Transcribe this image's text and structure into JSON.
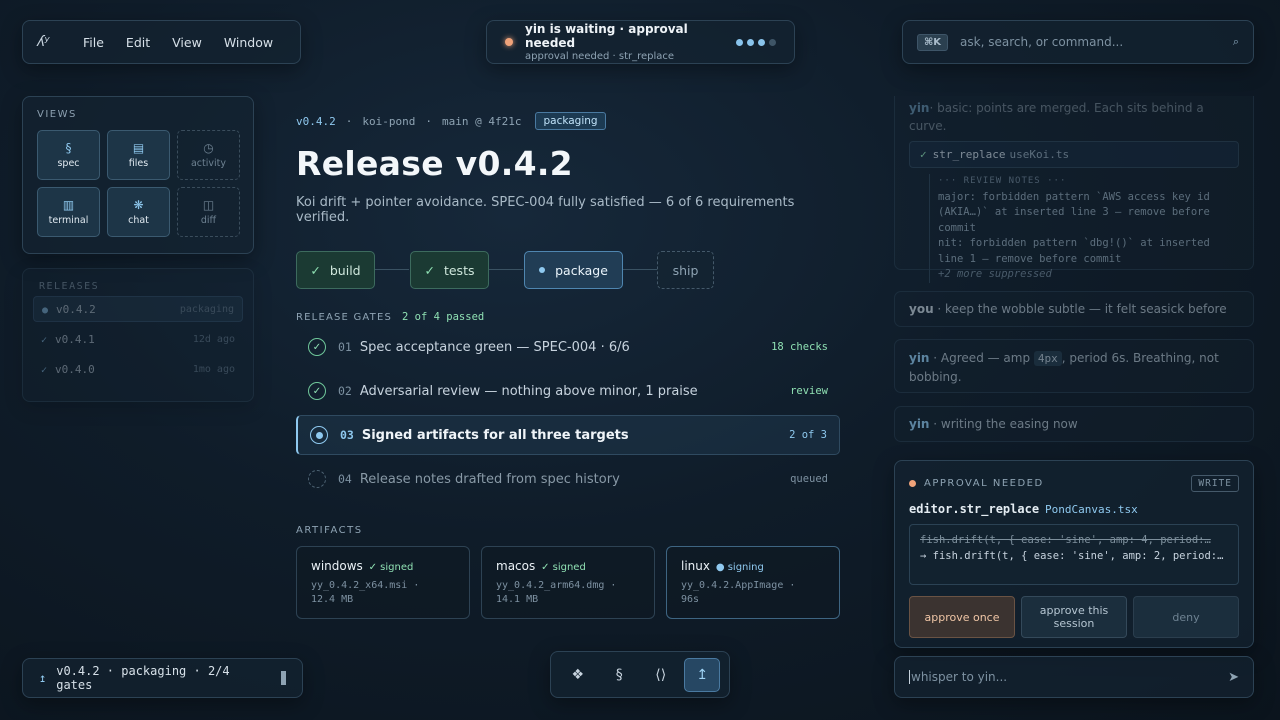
{
  "menubar": {
    "logo": "ʎʸ",
    "items": [
      "File",
      "Edit",
      "View",
      "Window"
    ]
  },
  "status": {
    "title": "yin is waiting · approval needed",
    "subtitle": "approval needed · str_replace",
    "dots_filled": 3,
    "dots_total": 4
  },
  "search": {
    "shortcut": "⌘K",
    "placeholder": "ask, search, or command..."
  },
  "views": {
    "label": "VIEWS",
    "items": [
      {
        "icon": "§",
        "label": "spec"
      },
      {
        "icon": "▤",
        "label": "files"
      },
      {
        "icon": "◷",
        "label": "activity"
      },
      {
        "icon": "▥",
        "label": "terminal"
      },
      {
        "icon": "❋",
        "label": "chat"
      },
      {
        "icon": "◫",
        "label": "diff"
      }
    ]
  },
  "releases": {
    "label": "RELEASES",
    "items": [
      {
        "marker": "●",
        "version": "v0.4.2",
        "meta": "packaging"
      },
      {
        "marker": "✓",
        "version": "v0.4.1",
        "meta": "12d ago"
      },
      {
        "marker": "✓",
        "version": "v0.4.0",
        "meta": "1mo ago"
      }
    ]
  },
  "bottom_status": {
    "icon": "↥",
    "text": "v0.4.2 · packaging · 2/4 gates"
  },
  "dock": {
    "items": [
      "❖",
      "§",
      "⟨⟩",
      "↥"
    ]
  },
  "main": {
    "version": "v0.4.2",
    "repo": "koi-pond",
    "branch": "main @ 4f21c",
    "sep": "·",
    "badge": "packaging",
    "title": "Release v0.4.2",
    "description": "Koi drift + pointer avoidance. SPEC-004 fully satisfied — 6 of 6 requirements verified.",
    "pipeline": [
      {
        "label": "build",
        "state": "done"
      },
      {
        "label": "tests",
        "state": "done"
      },
      {
        "label": "package",
        "state": "current"
      },
      {
        "label": "ship",
        "state": "todo"
      }
    ],
    "gates_label": "RELEASE GATES",
    "gates_count": "2 of 4 passed",
    "gates": [
      {
        "num": "01",
        "label": "Spec acceptance green — SPEC-004 · 6/6",
        "status": "18 checks",
        "state": "done"
      },
      {
        "num": "02",
        "label": "Adversarial review — nothing above minor, 1 praise",
        "status": "review",
        "state": "done"
      },
      {
        "num": "03",
        "label": "Signed artifacts for all three targets",
        "status": "2 of 3",
        "state": "current"
      },
      {
        "num": "04",
        "label": "Release notes drafted from spec history",
        "status": "queued",
        "state": "todo"
      }
    ],
    "artifacts_label": "ARTIFACTS",
    "artifacts": [
      {
        "name": "windows",
        "status": "✓ signed",
        "state": "ok",
        "file": "yy_0.4.2_x64.msi ·",
        "size": "12.4 MB"
      },
      {
        "name": "macos",
        "status": "✓ signed",
        "state": "ok",
        "file": "yy_0.4.2_arm64.dmg ·",
        "size": "14.1 MB"
      },
      {
        "name": "linux",
        "status": "● signing",
        "state": "run",
        "file": "yy_0.4.2.AppImage ·",
        "size": "96s"
      }
    ]
  },
  "chat": {
    "top_fragment_who": "yin",
    "top_fragment_text": "· basic: points are merged. Each sits behind a curve.",
    "tool_name": "str_replace",
    "tool_file": "useKoi.ts",
    "review_head": "··· REVIEW NOTES ···",
    "review_major": "major: forbidden pattern `AWS access key id (AKIA…)` at inserted line 3 — remove before commit",
    "review_nit": "nit: forbidden pattern `dbg!()` at inserted line 1 — remove before commit",
    "review_more": "+2 more suppressed",
    "messages": [
      {
        "who": "you",
        "text": " · keep the wobble subtle — it felt seasick before"
      },
      {
        "who": "yin",
        "pre": " · Agreed — amp ",
        "code": "4px",
        "post": ", period 6s. Breathing, not bobbing."
      },
      {
        "who": "yin",
        "text": " · writing the easing now"
      }
    ]
  },
  "approval": {
    "label": "APPROVAL NEEDED",
    "mode": "WRITE",
    "call": "editor.str_replace",
    "file": "PondCanvas.tsx",
    "diff_old": "fish.drift(t, { ease: 'sine', amp: 4, period:…",
    "diff_new": "→ fish.drift(t, { ease: 'sine', amp: 2, period:…",
    "buttons": [
      "approve once",
      "approve this session",
      "deny"
    ]
  },
  "whisper": {
    "placeholder": "whisper to yin...",
    "send_icon": "➤"
  }
}
